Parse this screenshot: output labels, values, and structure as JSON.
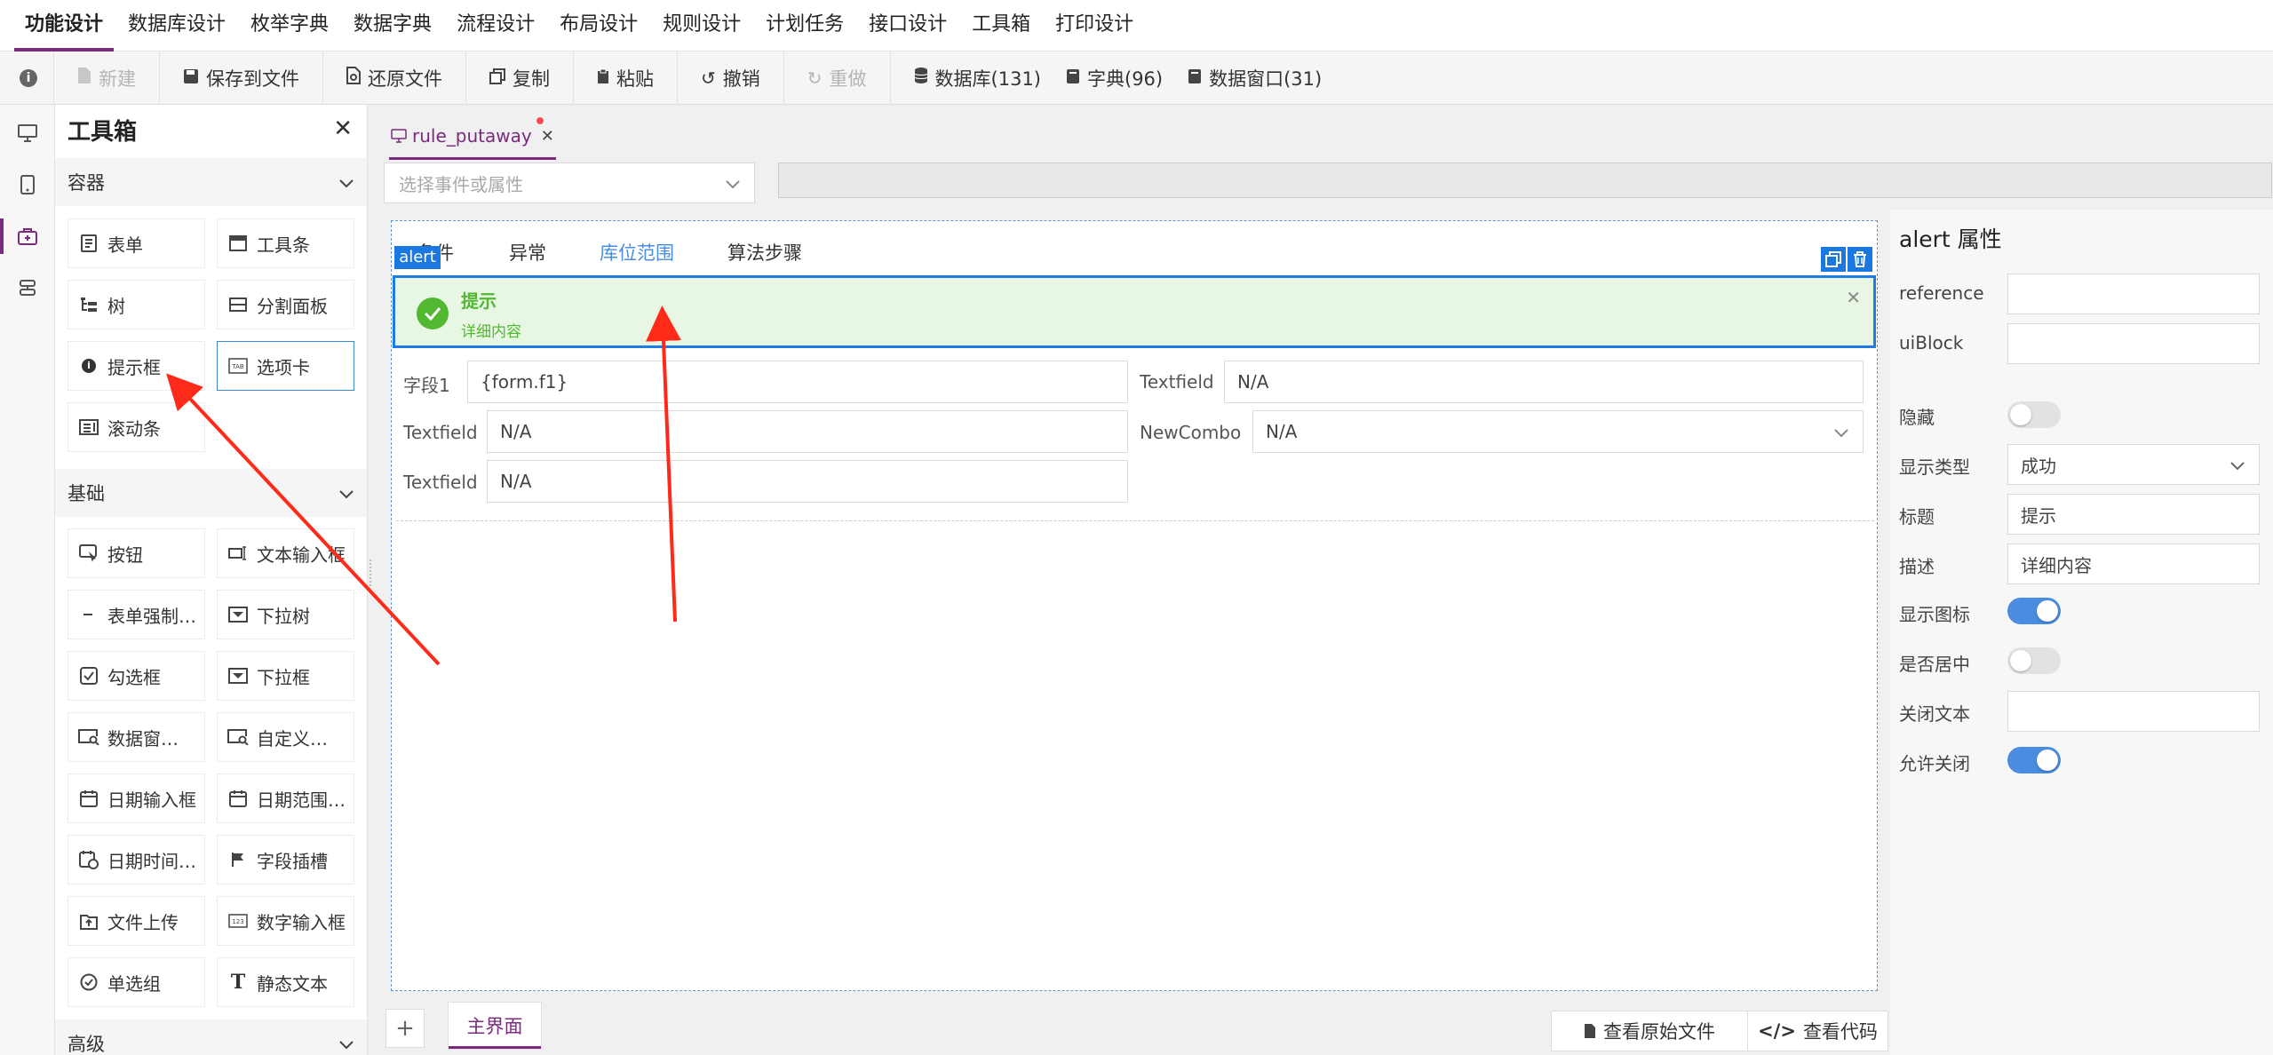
{
  "top_menu": [
    "功能设计",
    "数据库设计",
    "枚举字典",
    "数据字典",
    "流程设计",
    "布局设计",
    "规则设计",
    "计划任务",
    "接口设计",
    "工具箱",
    "打印设计"
  ],
  "toolbar": {
    "new": "新建",
    "save_file": "保存到文件",
    "restore_file": "还原文件",
    "copy": "复制",
    "paste": "粘贴",
    "undo": "撤销",
    "redo": "重做",
    "database": "数据库(131)",
    "dictionary": "字典(96)",
    "data_window": "数据窗口(31)"
  },
  "toolbox": {
    "title": "工具箱",
    "sections": {
      "containers": "容器",
      "basic": "基础",
      "advanced": "高级"
    },
    "containers": [
      "表单",
      "工具条",
      "树",
      "分割面板",
      "提示框",
      "选项卡",
      "滚动条"
    ],
    "basic": [
      "按钮",
      "文本输入框",
      "表单强制…",
      "下拉树",
      "勾选框",
      "下拉框",
      "数据窗…",
      "自定义…",
      "日期输入框",
      "日期范围…",
      "日期时间…",
      "字段插槽",
      "文件上传",
      "数字输入框",
      "单选组",
      "静态文本"
    ]
  },
  "editor": {
    "file_tab": "rule_putaway",
    "event_placeholder": "选择事件或属性",
    "canvas_tabs": [
      "条件",
      "异常",
      "库位范围",
      "算法步骤"
    ],
    "alert_tag": "alert",
    "alert": {
      "title": "提示",
      "description": "详细内容"
    },
    "fields": [
      {
        "label": "字段1",
        "value": "{form.f1}"
      },
      {
        "label": "Textfield",
        "value": "N/A"
      },
      {
        "label": "Textfield",
        "value": "N/A"
      },
      {
        "label": "NewCombo",
        "value": "N/A"
      },
      {
        "label": "Textfield",
        "value": "N/A"
      }
    ],
    "page_tab": "主界面",
    "view_source": "查看原始文件",
    "view_code": "查看代码"
  },
  "properties": {
    "title": "alert 属性",
    "reference_label": "reference",
    "reference_value": "",
    "uiblock_label": "uiBlock",
    "uiblock_value": "",
    "hidden_label": "隐藏",
    "hidden": false,
    "type_label": "显示类型",
    "type_value": "成功",
    "title_label": "标题",
    "title_value": "提示",
    "desc_label": "描述",
    "desc_value": "详细内容",
    "show_icon_label": "显示图标",
    "show_icon": true,
    "centered_label": "是否居中",
    "centered": false,
    "close_text_label": "关闭文本",
    "close_text_value": "",
    "closable_label": "允许关闭",
    "closable": true
  },
  "colors": {
    "accent": "#7b2b7b",
    "primary": "#1f7be0",
    "success": "#52b832",
    "arrow": "#ff2a1a"
  }
}
